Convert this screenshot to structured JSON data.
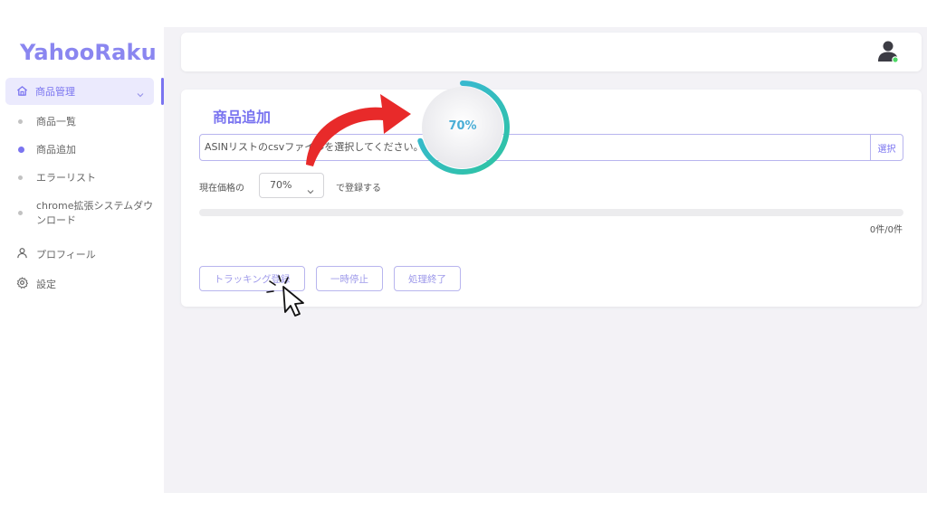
{
  "app": {
    "logo": "YahooRaku"
  },
  "sidebar": {
    "group_label": "商品管理",
    "sub_items": [
      {
        "label": "商品一覧",
        "active": false
      },
      {
        "label": "商品追加",
        "active": true
      },
      {
        "label": "エラーリスト",
        "active": false
      },
      {
        "label": "chrome拡張システムダウンロード",
        "active": false
      }
    ],
    "items": [
      {
        "label": "プロフィール",
        "icon": "user-icon"
      },
      {
        "label": "設定",
        "icon": "gear-icon"
      }
    ]
  },
  "main": {
    "title": "商品追加",
    "file_input": {
      "placeholder": "ASINリストのcsvファイルを選択してください。"
    },
    "select_button": "選択",
    "price_label": "現在価格の",
    "price_percent": "70%",
    "register_label": "で登録する",
    "progress": {
      "value": 0
    },
    "count": "0件/0件",
    "buttons": [
      "トラッキング登録",
      "一時停止",
      "処理終了"
    ]
  },
  "overlay": {
    "ring_label": "70%",
    "ring_value": 0.7
  },
  "colors": {
    "accent": "#7a74f0",
    "ring_start": "#2ec4a0",
    "ring_end": "#3ab5de",
    "arrow": "#e82a2a"
  }
}
